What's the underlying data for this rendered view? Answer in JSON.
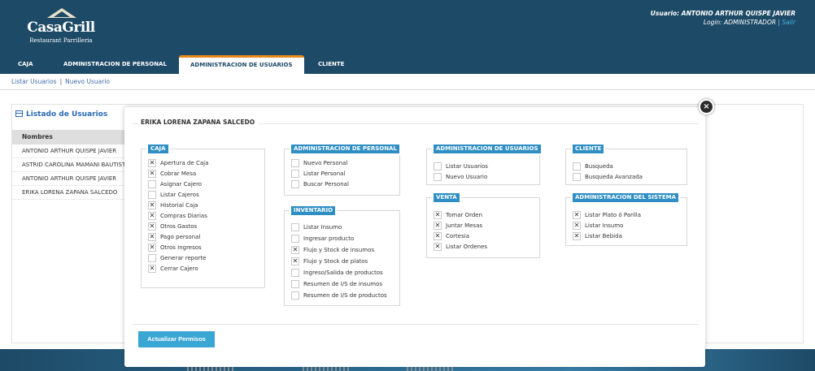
{
  "header": {
    "logo_name": "CasaGrill",
    "logo_sub": "Restaurant Parrilleria",
    "user_label": "Usuario: ANTONIO ARTHUR QUISPE JAVIER",
    "login_label": "Login: ADMINISTRADOR",
    "login_sep": "|",
    "logout_label": "Salir",
    "tabs": [
      {
        "label": "CAJA"
      },
      {
        "label": "ADMINISTRACION DE PERSONAL"
      },
      {
        "label": "ADMINISTRACION DE USUARIOS"
      },
      {
        "label": "CLIENTE"
      }
    ]
  },
  "subnav": {
    "list_users": "Listar Usuarios",
    "sep": "|",
    "new_user": "Nuevo Usuario"
  },
  "list": {
    "title": "Listado de Usuarios",
    "column": "Nombres",
    "rows": [
      "ANTONIO ARTHUR QUISPE JAVIER",
      "ASTRID CAROLINA MAMANI BAUTISTA",
      "ANTONIO ARTHUR QUISPE JAVIER",
      "ERIKA LORENA ZAPANA SALCEDO"
    ]
  },
  "modal": {
    "close_glyph": "×",
    "title": "ERIKA LORENA ZAPANA SALCEDO",
    "update_button": "Actualizar Permisos",
    "check_glyph": "✕",
    "groups": {
      "caja": {
        "legend": "CAJA",
        "options": [
          {
            "label": "Apertura de Caja",
            "checked": true
          },
          {
            "label": "Cobrar Mesa",
            "checked": true
          },
          {
            "label": "Asignar Cajero",
            "checked": false
          },
          {
            "label": "Listar Cajeros",
            "checked": false
          },
          {
            "label": "Historial Caja",
            "checked": true
          },
          {
            "label": "Compras Diarias",
            "checked": true
          },
          {
            "label": "Otros Gastos",
            "checked": true
          },
          {
            "label": "Pago personal",
            "checked": true
          },
          {
            "label": "Otros Ingresos",
            "checked": true
          },
          {
            "label": "Generar reporte",
            "checked": false
          },
          {
            "label": "Cerrar Cajero",
            "checked": true
          }
        ]
      },
      "personal": {
        "legend": "ADMINISTRACION DE PERSONAL",
        "options": [
          {
            "label": "Nuevo Personal",
            "checked": false
          },
          {
            "label": "Listar Personal",
            "checked": false
          },
          {
            "label": "Buscar Personal",
            "checked": false
          }
        ]
      },
      "inventario": {
        "legend": "INVENTARIO",
        "options": [
          {
            "label": "Listar Insumo",
            "checked": false
          },
          {
            "label": "Ingresar producto",
            "checked": false
          },
          {
            "label": "Flujo y Stock de insumos",
            "checked": true
          },
          {
            "label": "Flujo y Stock de platos",
            "checked": true
          },
          {
            "label": "Ingreso/Salida de productos",
            "checked": false
          },
          {
            "label": "Resumen de I/S de insumos",
            "checked": false
          },
          {
            "label": "Resumen de I/S de productos",
            "checked": false
          }
        ]
      },
      "usuarios": {
        "legend": "ADMINISTRACION DE USUARIOS",
        "options": [
          {
            "label": "Listar Usuarios",
            "checked": false
          },
          {
            "label": "Nuevo Usuario",
            "checked": false
          }
        ]
      },
      "venta": {
        "legend": "VENTA",
        "options": [
          {
            "label": "Tomar Orden",
            "checked": true
          },
          {
            "label": "Juntar Mesas",
            "checked": true
          },
          {
            "label": "Cortesia",
            "checked": true
          },
          {
            "label": "Listar Ordenes",
            "checked": true
          }
        ]
      },
      "cliente": {
        "legend": "CLIENTE",
        "options": [
          {
            "label": "Busqueda",
            "checked": false
          },
          {
            "label": "Busqueda Avanzada",
            "checked": false
          }
        ]
      },
      "sistema": {
        "legend": "ADMINISTRACION DEL SISTEMA",
        "options": [
          {
            "label": "Listar Plato ó Parilla",
            "checked": true
          },
          {
            "label": "Listar Insumo",
            "checked": true
          },
          {
            "label": "Listar Bebida",
            "checked": true
          }
        ]
      }
    }
  },
  "colors": {
    "header": "#1d4a66",
    "accent": "#2f8fc4",
    "tab_active_border": "#e88a1a",
    "button": "#3aa6d3"
  }
}
